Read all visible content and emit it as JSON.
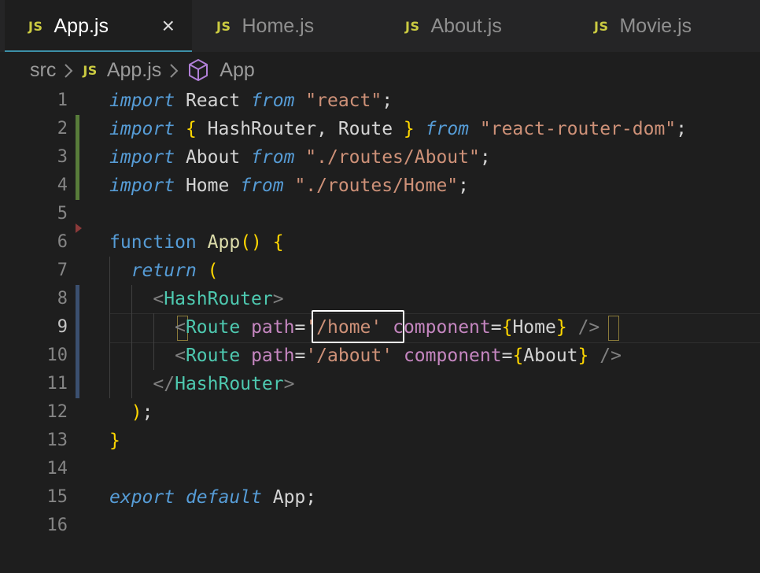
{
  "tabs": [
    {
      "badge": "JS",
      "label": "App.js",
      "active": true,
      "close_icon": "×"
    },
    {
      "badge": "JS",
      "label": "Home.js",
      "active": false
    },
    {
      "badge": "JS",
      "label": "About.js",
      "active": false
    },
    {
      "badge": "JS",
      "label": "Movie.js",
      "active": false
    }
  ],
  "breadcrumb": {
    "folder": "src",
    "file_badge": "JS",
    "file": "App.js",
    "symbol": "App",
    "symbol_icon": "cube-icon"
  },
  "editor": {
    "current_line": 9,
    "highlighted_text": "'/home'",
    "lines": [
      {
        "n": "1",
        "text": "import React from \"react\";"
      },
      {
        "n": "2",
        "text": "import { HashRouter, Route } from \"react-router-dom\";"
      },
      {
        "n": "3",
        "text": "import About from \"./routes/About\";"
      },
      {
        "n": "4",
        "text": "import Home from \"./routes/Home\";"
      },
      {
        "n": "5",
        "text": ""
      },
      {
        "n": "6",
        "text": "function App() {"
      },
      {
        "n": "7",
        "text": "  return ("
      },
      {
        "n": "8",
        "text": "    <HashRouter>"
      },
      {
        "n": "9",
        "text": "      <Route path='/home' component={Home} />"
      },
      {
        "n": "10",
        "text": "      <Route path='/about' component={About} />"
      },
      {
        "n": "11",
        "text": "    </HashRouter>"
      },
      {
        "n": "12",
        "text": "  );"
      },
      {
        "n": "13",
        "text": "}"
      },
      {
        "n": "14",
        "text": ""
      },
      {
        "n": "15",
        "text": "export default App;"
      },
      {
        "n": "16",
        "text": ""
      }
    ]
  },
  "colors": {
    "background": "#1e1e1e",
    "tabbar": "#252526",
    "active_tab_underline": "#3c8fa8",
    "js_badge": "#cbcb41",
    "added_line_marker": "#587c3a",
    "modified_line_marker": "#3b5070"
  }
}
